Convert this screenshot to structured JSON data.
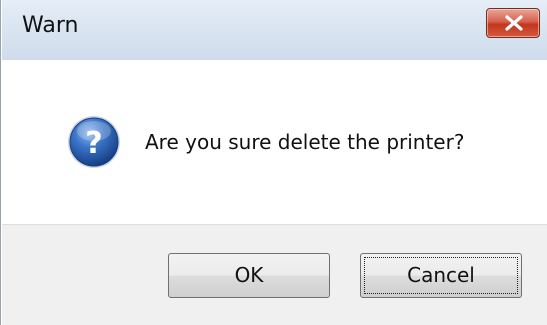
{
  "window": {
    "title": "Warn",
    "close_icon": "close-icon"
  },
  "dialog": {
    "icon": "question-icon",
    "message": "Are you sure delete the printer?"
  },
  "buttons": {
    "ok_label": "OK",
    "cancel_label": "Cancel"
  },
  "colors": {
    "close_button": "#c2361d",
    "icon_blue": "#2a62b8",
    "title_bar": "#dbe6f2",
    "footer": "#f0f0f0"
  }
}
